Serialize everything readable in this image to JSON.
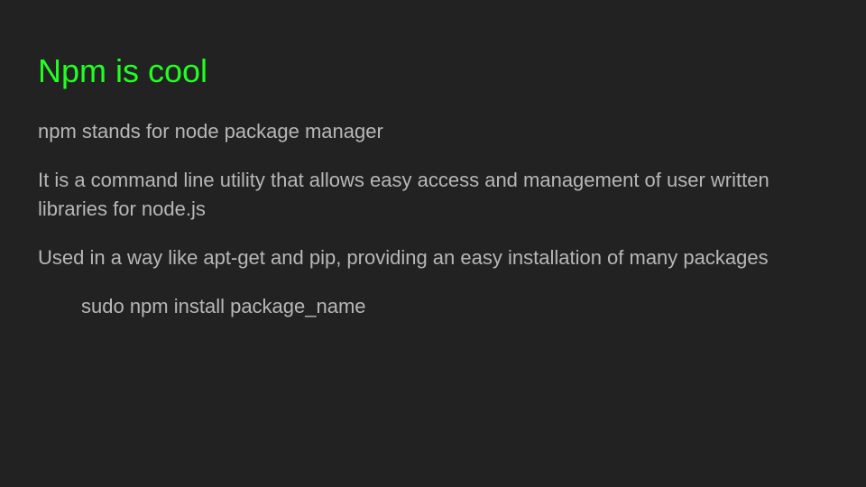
{
  "slide": {
    "title": "Npm is cool",
    "colors": {
      "background": "#222222",
      "title": "#21ff21",
      "body_text": "#b7b7b7"
    },
    "paragraphs": [
      "npm stands for node package manager",
      "It is a command line utility that allows easy access and management of user written libraries for node.js",
      "Used in a way like apt-get and pip, providing an easy installation of many packages",
      "sudo npm install package_name"
    ]
  }
}
